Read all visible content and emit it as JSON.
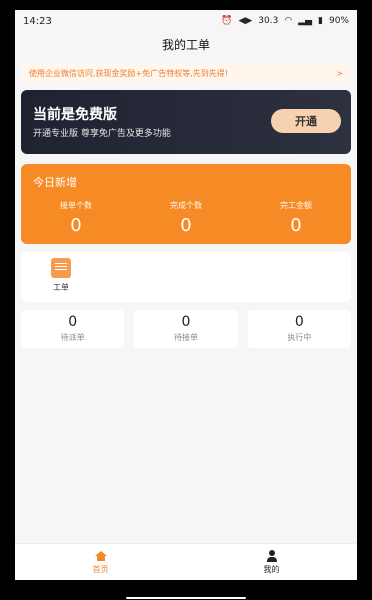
{
  "status_bar": {
    "time": "14:23",
    "network_speed": "30.3",
    "battery": "90%"
  },
  "header": {
    "title": "我的工单"
  },
  "notice": {
    "text": "使用企业微信访问,获现金奖励+免广告特权等,先到先得!",
    "arrow": ">"
  },
  "vip": {
    "title": "当前是免费版",
    "subtitle": "开通专业版 尊享免广告及更多功能",
    "button": "开通"
  },
  "today": {
    "title": "今日新增",
    "stats": [
      {
        "label": "接单个数",
        "value": "0"
      },
      {
        "label": "完成个数",
        "value": "0"
      },
      {
        "label": "完工金额",
        "value": "0"
      }
    ]
  },
  "modules": [
    {
      "label": "工单",
      "icon": "work-order-icon"
    }
  ],
  "counters": [
    {
      "value": "0",
      "label": "待派单"
    },
    {
      "value": "0",
      "label": "待接单"
    },
    {
      "value": "0",
      "label": "执行中"
    }
  ],
  "bottom_nav": [
    {
      "label": "首页",
      "icon": "home-icon",
      "active": true
    },
    {
      "label": "我的",
      "icon": "user-icon",
      "active": false
    }
  ],
  "colors": {
    "accent": "#f68a25",
    "vip_button": "#f7d2b0",
    "notice_text": "#ef7f2f"
  }
}
